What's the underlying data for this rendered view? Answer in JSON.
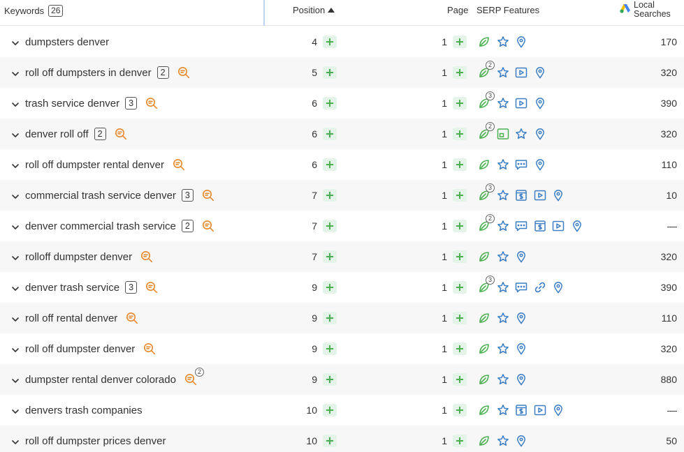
{
  "header": {
    "keywords_label": "Keywords",
    "keywords_count": "26",
    "position_label": "Position",
    "page_label": "Page",
    "serp_label": "SERP Features",
    "local_label_line1": "Local",
    "local_label_line2": "Searches"
  },
  "colors": {
    "green": "#4caf50",
    "blue": "#3d7fc4",
    "orange": "#e8892b",
    "row_alt": "#f7f7f7"
  },
  "rows": [
    {
      "keyword": "dumpsters denver",
      "count": "",
      "intent": false,
      "intent_count": "",
      "position": "4",
      "page": "1",
      "features": [
        "leaf-icon",
        "star-icon",
        "pin-icon"
      ],
      "leaf_count": "",
      "local": "170"
    },
    {
      "keyword": "roll off dumpsters in denver",
      "count": "2",
      "intent": true,
      "intent_count": "",
      "position": "5",
      "page": "1",
      "features": [
        "leaf-icon",
        "star-icon",
        "video-icon",
        "pin-icon"
      ],
      "leaf_count": "2",
      "local": "320"
    },
    {
      "keyword": "trash service denver",
      "count": "3",
      "intent": true,
      "intent_count": "",
      "position": "6",
      "page": "1",
      "features": [
        "leaf-icon",
        "star-icon",
        "video-icon",
        "pin-icon"
      ],
      "leaf_count": "3",
      "local": "390"
    },
    {
      "keyword": "denver roll off",
      "count": "2",
      "intent": true,
      "intent_count": "",
      "position": "6",
      "page": "1",
      "features": [
        "leaf-icon",
        "image-icon",
        "star-icon",
        "pin-icon"
      ],
      "leaf_count": "2",
      "local": "320"
    },
    {
      "keyword": "roll off dumpster rental denver",
      "count": "",
      "intent": true,
      "intent_count": "",
      "position": "6",
      "page": "1",
      "features": [
        "leaf-icon",
        "star-icon",
        "reviews-icon",
        "pin-icon"
      ],
      "leaf_count": "",
      "local": "110"
    },
    {
      "keyword": "commercial trash service denver",
      "count": "3",
      "intent": true,
      "intent_count": "",
      "position": "7",
      "page": "1",
      "features": [
        "leaf-icon",
        "star-icon",
        "shopping-icon",
        "video-icon",
        "pin-icon"
      ],
      "leaf_count": "3",
      "local": "10"
    },
    {
      "keyword": "denver commercial trash service",
      "count": "2",
      "intent": true,
      "intent_count": "",
      "position": "7",
      "page": "1",
      "features": [
        "leaf-icon",
        "star-icon",
        "reviews-icon",
        "shopping-icon",
        "video-icon",
        "pin-icon"
      ],
      "leaf_count": "2",
      "local": "—"
    },
    {
      "keyword": "rolloff dumpster denver",
      "count": "",
      "intent": true,
      "intent_count": "",
      "position": "7",
      "page": "1",
      "features": [
        "leaf-icon",
        "star-icon",
        "pin-icon"
      ],
      "leaf_count": "",
      "local": "320"
    },
    {
      "keyword": "denver trash service",
      "count": "3",
      "intent": true,
      "intent_count": "",
      "position": "9",
      "page": "1",
      "features": [
        "leaf-icon",
        "star-icon",
        "reviews-icon",
        "link-icon",
        "pin-icon"
      ],
      "leaf_count": "3",
      "local": "390"
    },
    {
      "keyword": "roll off rental denver",
      "count": "",
      "intent": true,
      "intent_count": "",
      "position": "9",
      "page": "1",
      "features": [
        "leaf-icon",
        "star-icon",
        "pin-icon"
      ],
      "leaf_count": "",
      "local": "110"
    },
    {
      "keyword": "roll off dumpster denver",
      "count": "",
      "intent": true,
      "intent_count": "",
      "position": "9",
      "page": "1",
      "features": [
        "leaf-icon",
        "star-icon",
        "pin-icon"
      ],
      "leaf_count": "",
      "local": "320"
    },
    {
      "keyword": "dumpster rental denver colorado",
      "count": "",
      "intent": true,
      "intent_count": "2",
      "position": "9",
      "page": "1",
      "features": [
        "leaf-icon",
        "star-icon",
        "pin-icon"
      ],
      "leaf_count": "",
      "local": "880"
    },
    {
      "keyword": "denvers trash companies",
      "count": "",
      "intent": false,
      "intent_count": "",
      "position": "10",
      "page": "1",
      "features": [
        "leaf-icon",
        "star-icon",
        "shopping-icon",
        "video-icon",
        "pin-icon"
      ],
      "leaf_count": "",
      "local": "—"
    },
    {
      "keyword": "roll off dumpster prices denver",
      "count": "",
      "intent": false,
      "intent_count": "",
      "position": "10",
      "page": "1",
      "features": [
        "leaf-icon",
        "star-icon",
        "pin-icon"
      ],
      "leaf_count": "",
      "local": "50"
    }
  ]
}
